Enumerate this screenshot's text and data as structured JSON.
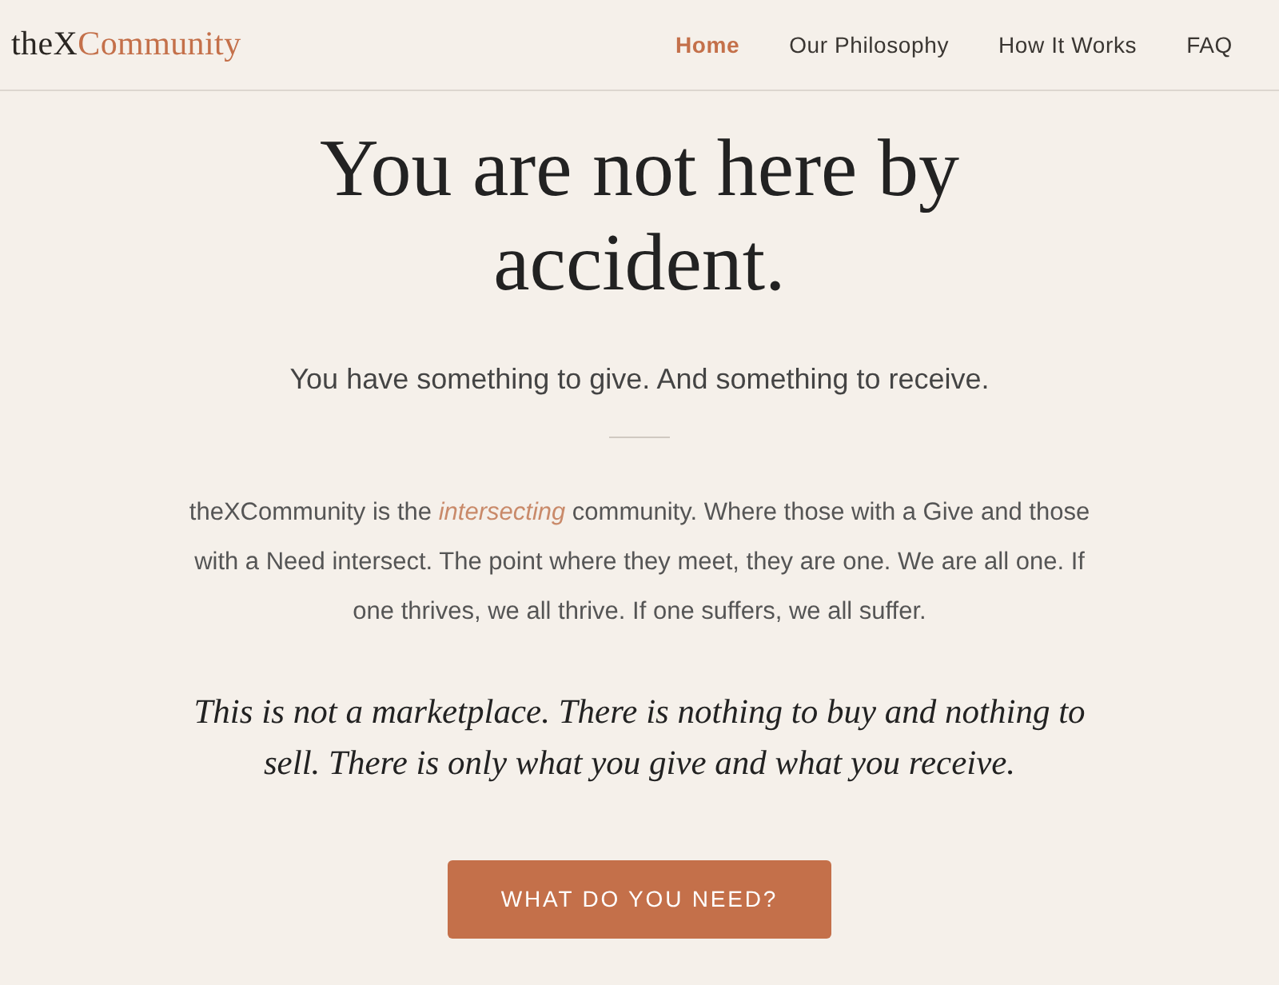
{
  "navbar": {
    "logo": {
      "part_1": "theX",
      "part_2": "Community"
    },
    "links": [
      {
        "label": "Home",
        "selected": true
      },
      {
        "label": "Our Philosophy",
        "selected": false
      },
      {
        "label": "How It Works",
        "selected": false
      },
      {
        "label": "FAQ",
        "selected": false
      }
    ]
  },
  "hero": {
    "title": "You are not here by accident.",
    "subtitle": "You have something to give. And something to receive.",
    "intro": "theXCommunity is the *intersecting* community. Where those with a Give and those with a Need intersect. The point where they meet, they are one. We are all one. If one thrives, we all thrive. If one suffers, we all suffer.",
    "quote": "This is not a marketplace. There is nothing to buy and nothing to sell. There is only what you give and what you receive.",
    "button": "WHAT DO YOU NEED?"
  }
}
